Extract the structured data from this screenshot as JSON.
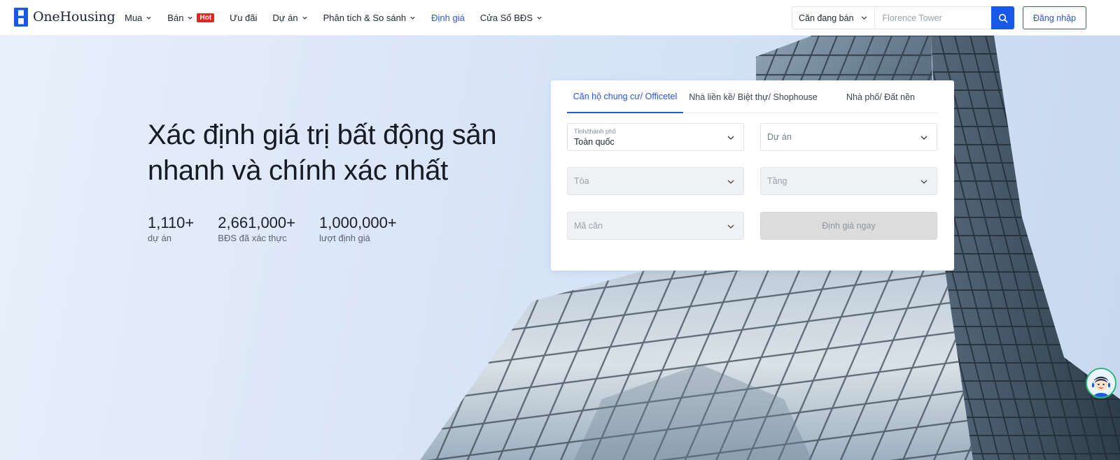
{
  "brand": {
    "name": "OneHousing",
    "primary_color": "#1857e8"
  },
  "nav": {
    "items": [
      {
        "label": "Mua",
        "has_dropdown": true
      },
      {
        "label": "Bán",
        "has_dropdown": true,
        "badge": "Hot"
      },
      {
        "label": "Ưu đãi",
        "has_dropdown": false
      },
      {
        "label": "Dự án",
        "has_dropdown": true
      },
      {
        "label": "Phân tích & So sánh",
        "has_dropdown": true
      },
      {
        "label": "Định giá",
        "has_dropdown": false,
        "active": true
      },
      {
        "label": "Cửa Sổ BĐS",
        "has_dropdown": true
      }
    ]
  },
  "search": {
    "category": "Căn đang bán",
    "placeholder": "Florence Tower",
    "button_icon": "search-icon"
  },
  "auth": {
    "login_label": "Đăng nhập"
  },
  "hero": {
    "headline_line1": "Xác định giá trị bất động sản",
    "headline_line2": "nhanh và chính xác nhất",
    "stats": [
      {
        "value": "1,110+",
        "label": "dự án"
      },
      {
        "value": "2,661,000+",
        "label": "BĐS đã xác thực"
      },
      {
        "value": "1,000,000+",
        "label": "lượt định giá"
      }
    ]
  },
  "form": {
    "tabs": [
      {
        "label": "Căn hộ chung cư/ Officetel",
        "active": true
      },
      {
        "label": "Nhà liền kề/ Biệt thự/ Shophouse",
        "active": false
      },
      {
        "label": "Nhà phố/ Đất nền",
        "active": false
      }
    ],
    "city": {
      "label": "Tỉnh/thành phố",
      "value": "Toàn quốc"
    },
    "project": {
      "placeholder": "Dự án"
    },
    "tower": {
      "placeholder": "Tòa",
      "disabled": true
    },
    "floor": {
      "placeholder": "Tầng",
      "disabled": true
    },
    "unit_code": {
      "placeholder": "Mã căn",
      "disabled": true
    },
    "submit_label": "Định giá ngay"
  },
  "support": {
    "icon": "support-chat-avatar-icon"
  }
}
